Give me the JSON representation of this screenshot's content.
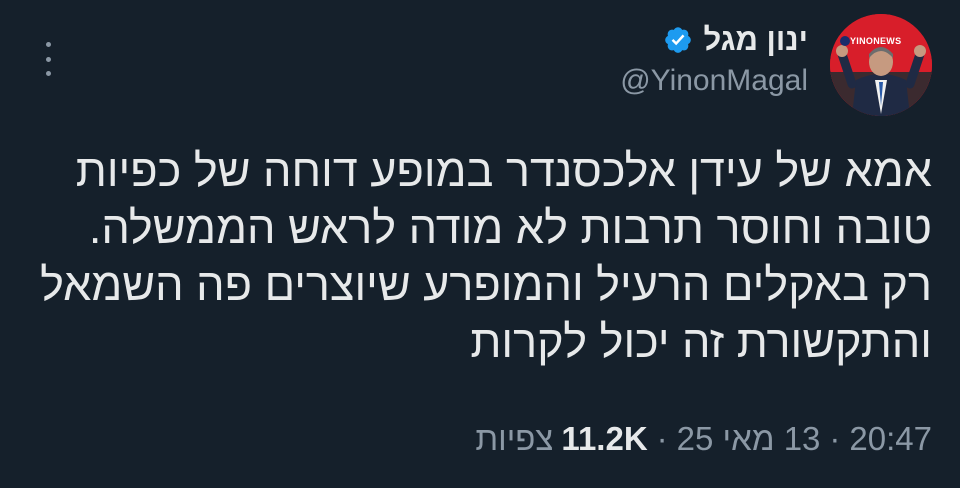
{
  "tweet": {
    "author": {
      "display_name": "ינון מגל",
      "handle": "@YinonMagal",
      "verified": true,
      "avatar_badge": "YINONEWS",
      "avatar_badge_mark": "YM"
    },
    "text_lines": [
      "אמא של עידן אלכסנדר במופע דוחה של כפיות",
      "טובה וחוסר תרבות לא מודה לראש הממשלה.",
      "רק באקלים הרעיל והמופרע שיוצרים פה השמאל",
      "והתקשורת זה יכול לקרות"
    ],
    "time": "20:47",
    "separator": "·",
    "date": "13 מאי 25",
    "views_count": "11.2K",
    "views_label": "צפיות"
  },
  "colors": {
    "background": "#15202b",
    "text": "#e7e9ea",
    "secondary_text": "#8b98a5",
    "verified_badge": "#1d9bf0",
    "avatar_bg": "#d81e2a"
  },
  "icons": {
    "more": "more-vertical-icon",
    "verified": "verified-badge-icon"
  }
}
